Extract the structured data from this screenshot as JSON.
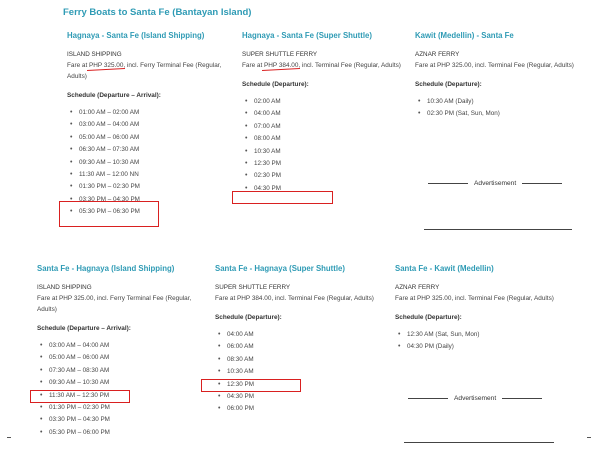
{
  "page_title": "Ferry Boats to Santa Fe (Bantayan Island)",
  "advertisement_label": "Advertisement",
  "top": [
    {
      "title": "Hagnaya - Santa Fe (Island Shipping)",
      "operator": "ISLAND SHIPPING",
      "fare_prefix": "Fare at ",
      "fare_amount": "PHP 325.00",
      "fare_suffix": ", incl. Ferry Terminal Fee (Regular, Adults)",
      "schedule_label": "Schedule (Departure – Arrival):",
      "times": [
        "01:00 AM – 02:00 AM",
        "03:00 AM – 04:00 AM",
        "05:00 AM – 06:00 AM",
        "06:30 AM – 07:30 AM",
        "09:30 AM – 10:30 AM",
        "11:30 AM – 12:00 NN",
        "01:30 PM – 02:30 PM",
        "03:30 PM – 04:30 PM",
        "05:30 PM – 06:30 PM"
      ]
    },
    {
      "title": "Hagnaya - Santa Fe (Super Shuttle)",
      "operator": "SUPER SHUTTLE FERRY",
      "fare_prefix": "Fare at ",
      "fare_amount": "PHP 384.00",
      "fare_suffix": ", incl. Terminal Fee (Regular, Adults)",
      "schedule_label": "Schedule (Departure):",
      "times": [
        "02:00 AM",
        "04:00 AM",
        "07:00 AM",
        "08:00 AM",
        "10:30 AM",
        "12:30 PM",
        "02:30 PM",
        "04:30 PM"
      ]
    },
    {
      "title": "Kawit (Medellin) - Santa Fe",
      "operator": "AZNAR FERRY",
      "fare_prefix": "Fare at ",
      "fare_amount": "PHP 325.00",
      "fare_suffix": ", incl. Terminal Fee (Regular, Adults)",
      "schedule_label": "Schedule (Departure):",
      "times": [
        "10:30 AM (Daily)",
        "02:30 PM (Sat, Sun, Mon)"
      ]
    }
  ],
  "bottom": [
    {
      "title": "Santa Fe - Hagnaya (Island Shipping)",
      "operator": "ISLAND SHIPPING",
      "fare": "Fare at PHP 325.00, incl. Ferry Terminal Fee (Regular, Adults)",
      "schedule_label": "Schedule (Departure – Arrival):",
      "times": [
        "03:00 AM – 04:00 AM",
        "05:00 AM – 06:00 AM",
        "07:30 AM – 08:30 AM",
        "09:30 AM – 10:30 AM",
        "11:30 AM – 12:30 PM",
        "01:30 PM – 02:30 PM",
        "03:30 PM – 04:30 PM",
        "05:30 PM – 06:00 PM"
      ]
    },
    {
      "title": "Santa Fe - Hagnaya (Super Shuttle)",
      "operator": "SUPER SHUTTLE FERRY",
      "fare": "Fare at PHP 384.00, incl. Terminal Fee (Regular, Adults)",
      "schedule_label": "Schedule (Departure):",
      "times": [
        "04:00 AM",
        "06:00 AM",
        "08:30 AM",
        "10:30 AM",
        "12:30 PM",
        "04:30 PM",
        "06:00 PM"
      ]
    },
    {
      "title": "Santa Fe - Kawit (Medellin)",
      "operator": "AZNAR FERRY",
      "fare": "Fare at PHP 325.00, incl. Terminal Fee (Regular, Adults)",
      "schedule_label": "Schedule (Departure):",
      "times": [
        "12:30 AM (Sat, Sun, Mon)",
        "04:30 PM (Daily)"
      ]
    }
  ]
}
